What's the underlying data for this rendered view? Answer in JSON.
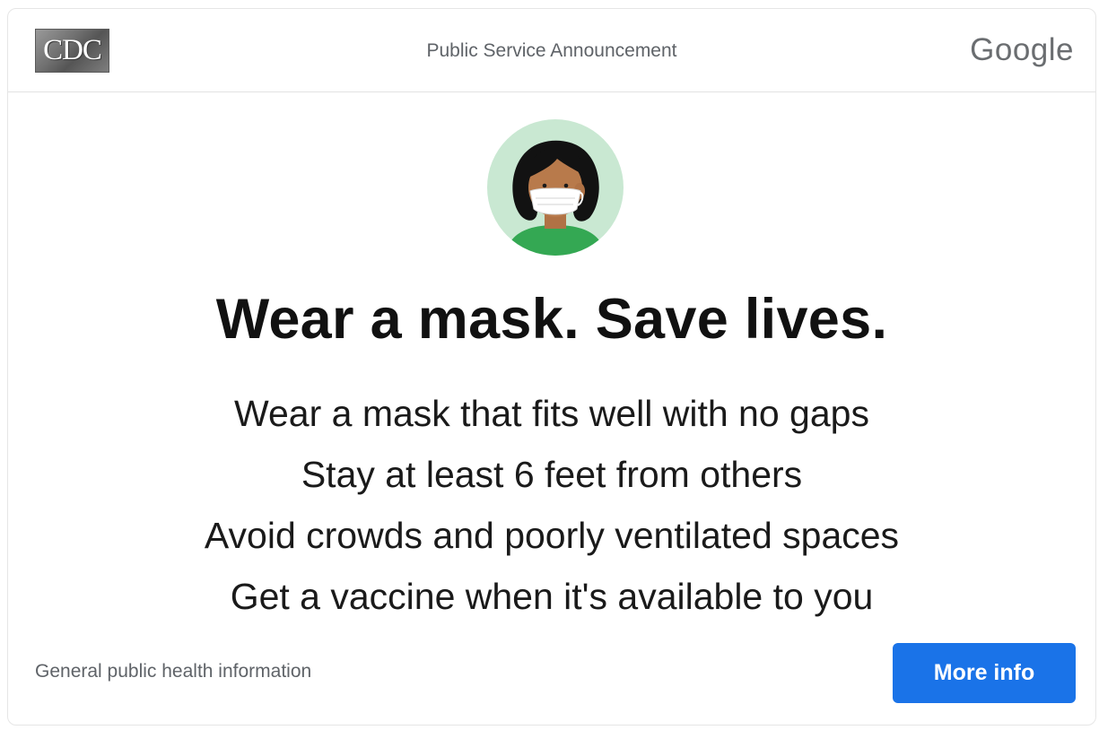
{
  "header": {
    "logo_text": "CDC",
    "title": "Public Service Announcement",
    "brand": "Google"
  },
  "illustration": {
    "icon": "masked-person-avatar",
    "colors": {
      "background": "#c9e8d2",
      "hair": "#121212",
      "skin": "#b87a4b",
      "mask": "#ffffff",
      "shirt": "#34a853"
    }
  },
  "main": {
    "headline": "Wear a mask. Save lives.",
    "tips": [
      "Wear a mask that fits well with no gaps",
      "Stay at least 6 feet from others",
      "Avoid crowds and poorly ventilated spaces",
      "Get a vaccine when it's available to you"
    ]
  },
  "footer": {
    "note": "General public health information",
    "button_label": "More info",
    "button_color": "#1a73e8"
  }
}
